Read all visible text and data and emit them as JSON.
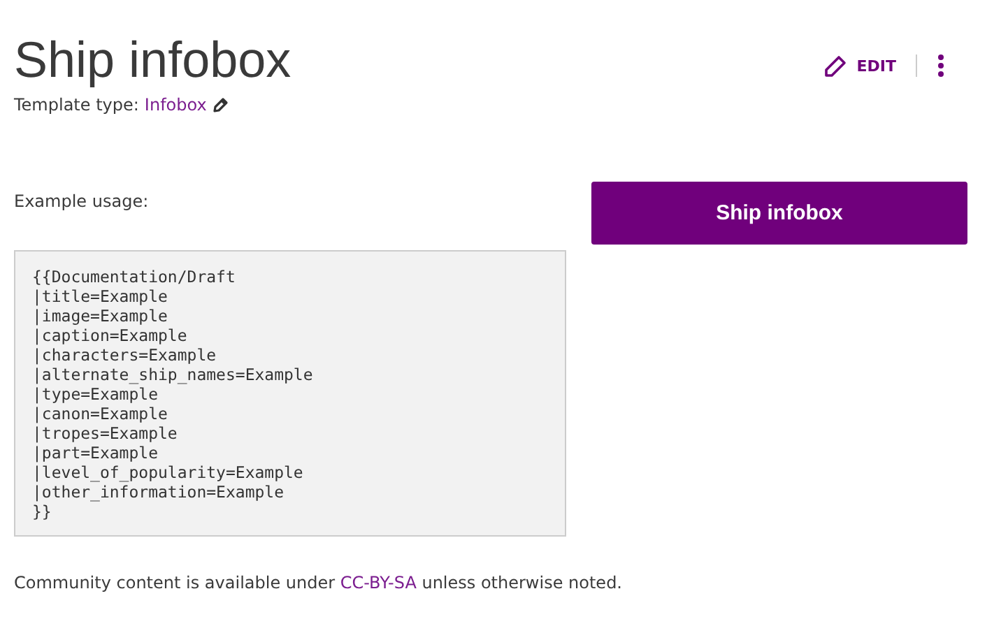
{
  "page_title": "Ship infobox",
  "template_type": {
    "label": "Template type:",
    "link": "Infobox"
  },
  "actions": {
    "edit": "EDIT"
  },
  "example_label": "Example usage:",
  "code_lines": [
    "{{Documentation/Draft",
    "|title=Example",
    "|image=Example",
    "|caption=Example",
    "|characters=Example",
    "|alternate_ship_names=Example",
    "|type=Example",
    "|canon=Example",
    "|tropes=Example",
    "|part=Example",
    "|level_of_popularity=Example",
    "|other_information=Example",
    "}}"
  ],
  "infobox_title": "Ship infobox",
  "footer": {
    "before": "Community content is available under",
    "link": "CC-BY-SA",
    "after": "unless otherwise noted."
  }
}
